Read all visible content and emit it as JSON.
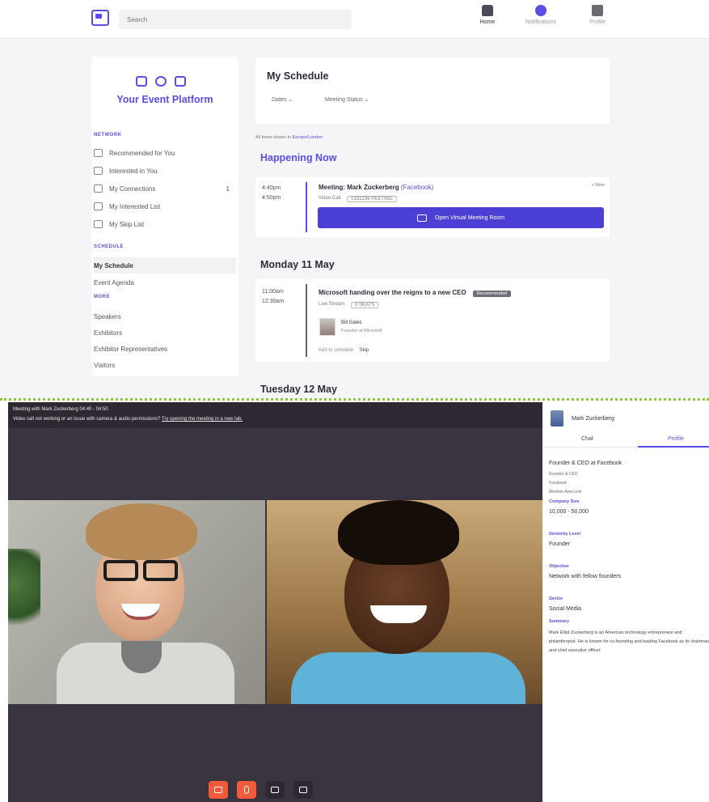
{
  "topbar": {
    "search_placeholder": "Search",
    "nav": [
      {
        "label": "Home"
      },
      {
        "label": "Notifications"
      },
      {
        "label": "Profile"
      }
    ]
  },
  "sidebar": {
    "brand": "Your Event Platform",
    "network_heading": "NETWORK",
    "network_items": [
      {
        "label": "Recommended for You"
      },
      {
        "label": "Interested in You"
      },
      {
        "label": "My Connections",
        "count": "1"
      },
      {
        "label": "My Interested List"
      },
      {
        "label": "My Skip List"
      }
    ],
    "schedule_heading": "SCHEDULE",
    "schedule_items": [
      {
        "label": "My Schedule"
      },
      {
        "label": "Event Agenda"
      }
    ],
    "more_heading": "MORE",
    "more_items": [
      {
        "label": "Speakers"
      },
      {
        "label": "Exhibitors"
      },
      {
        "label": "Exhibitor Representatives"
      },
      {
        "label": "Visitors"
      }
    ]
  },
  "schedule": {
    "title": "My Schedule",
    "filters": [
      "Dates",
      "Meeting Status"
    ],
    "tz_prefix": "All times shown in",
    "tz_link": "Europe/London",
    "happening_now": "Happening Now",
    "now_event": {
      "start": "4:40pm",
      "end": "4:50pm",
      "title": "Meeting: Mark Zuckerberg",
      "org": "(Facebook)",
      "location": "Video Call",
      "chip": "0191236 PEETING",
      "more": "+ More",
      "button": "Open Virtual Meeting Room"
    },
    "day1": "Monday 11 May",
    "day1_event": {
      "start": "11:00am",
      "end": "12:30am",
      "title": "Microsoft handing over the reigns to a new CEO",
      "tag": "Recommended",
      "location": "Live Stream",
      "chip": "0 SEATS",
      "speaker_name": "Bill Gates",
      "speaker_role": "Founder at Microsoft",
      "add": "Add to schedule",
      "skip": "Skip"
    },
    "day2": "Tuesday 12 May"
  },
  "call": {
    "title": "Meeting with Mark Zuckerberg 04:40 - 04:50",
    "warn": "Video call not working or an issue with camera & audio permissions?",
    "warn_link": "Try opening the meeting in a new tab.",
    "controls": [
      "camera",
      "mic",
      "screen",
      "participants"
    ]
  },
  "profile": {
    "name": "Mark Zuckerberg",
    "tabs": [
      "Chat",
      "Profile"
    ],
    "headline": "Founder & CEO at Facebook",
    "line1": "Founder & CEO",
    "line2": "Facebook",
    "line3": "Member Area Link",
    "company_size_label": "Company Size",
    "company_size": "10,000 - 50,000",
    "seniority_label": "Seniority Level",
    "seniority": "Founder",
    "objective_label": "Objective",
    "objective": "Network with fellow founders",
    "sector_label": "Sector",
    "sector": "Social Media",
    "summary_label": "Summary",
    "summary": "Mark Elliot Zuckerberg is an American technology entrepreneur and philanthropist. He is known for co-founding and leading Facebook as its chairman and chief executive officer."
  },
  "colors": {
    "accent": "#5a4ee6",
    "control_orange": "#f15a3a",
    "separator": "#8ec63f"
  }
}
